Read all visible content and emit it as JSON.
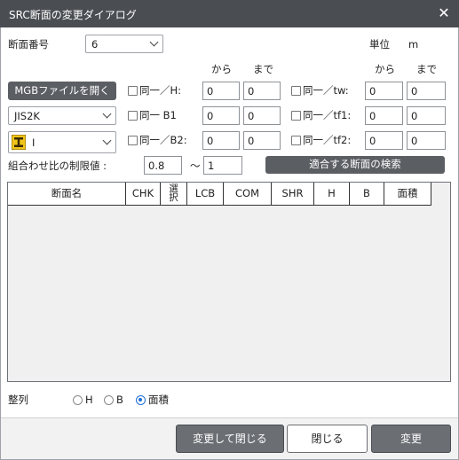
{
  "window": {
    "title": "SRC断面の変更ダイアログ",
    "close_glyph": "✕"
  },
  "section_number": {
    "label": "断面番号",
    "value": "6"
  },
  "unit": {
    "label": "単位",
    "value": "m"
  },
  "range_headers": {
    "from": "から",
    "to": "まで"
  },
  "mgb_button": "MGBファイルを開く",
  "standard_select": {
    "value": "JIS2K"
  },
  "shape_select": {
    "value": "I",
    "icon": "i-beam-icon"
  },
  "rows_left": [
    {
      "check_label": "同一／H:",
      "from": "0",
      "to": "0"
    },
    {
      "check_label": "同一 B1",
      "from": "0",
      "to": "0"
    },
    {
      "check_label": "同一／B2:",
      "from": "0",
      "to": "0"
    }
  ],
  "rows_right": [
    {
      "check_label": "同一／tw:",
      "from": "0",
      "to": "0"
    },
    {
      "check_label": "同一／tf1:",
      "from": "0",
      "to": "0"
    },
    {
      "check_label": "同一／tf2:",
      "from": "0",
      "to": "0"
    }
  ],
  "ratio_limit": {
    "label": "組合わせ比の制限値 :",
    "from": "0.8",
    "sep": "～",
    "to": "1"
  },
  "search_button": "適合する断面の検索",
  "table": {
    "columns": [
      "断面名",
      "CHK",
      "選\n択",
      "LCB",
      "COM",
      "SHR",
      "H",
      "B",
      "面積"
    ],
    "rows": []
  },
  "sort": {
    "label": "整列",
    "options": [
      "H",
      "B",
      "面積"
    ],
    "selected": "面積"
  },
  "buttons": {
    "change_close": "変更して閉じる",
    "close": "閉じる",
    "change": "変更"
  },
  "colors": {
    "titlebar": "#4a4d52",
    "dark_button": "#5b5e63",
    "radio_accent": "#1c6fd6"
  }
}
